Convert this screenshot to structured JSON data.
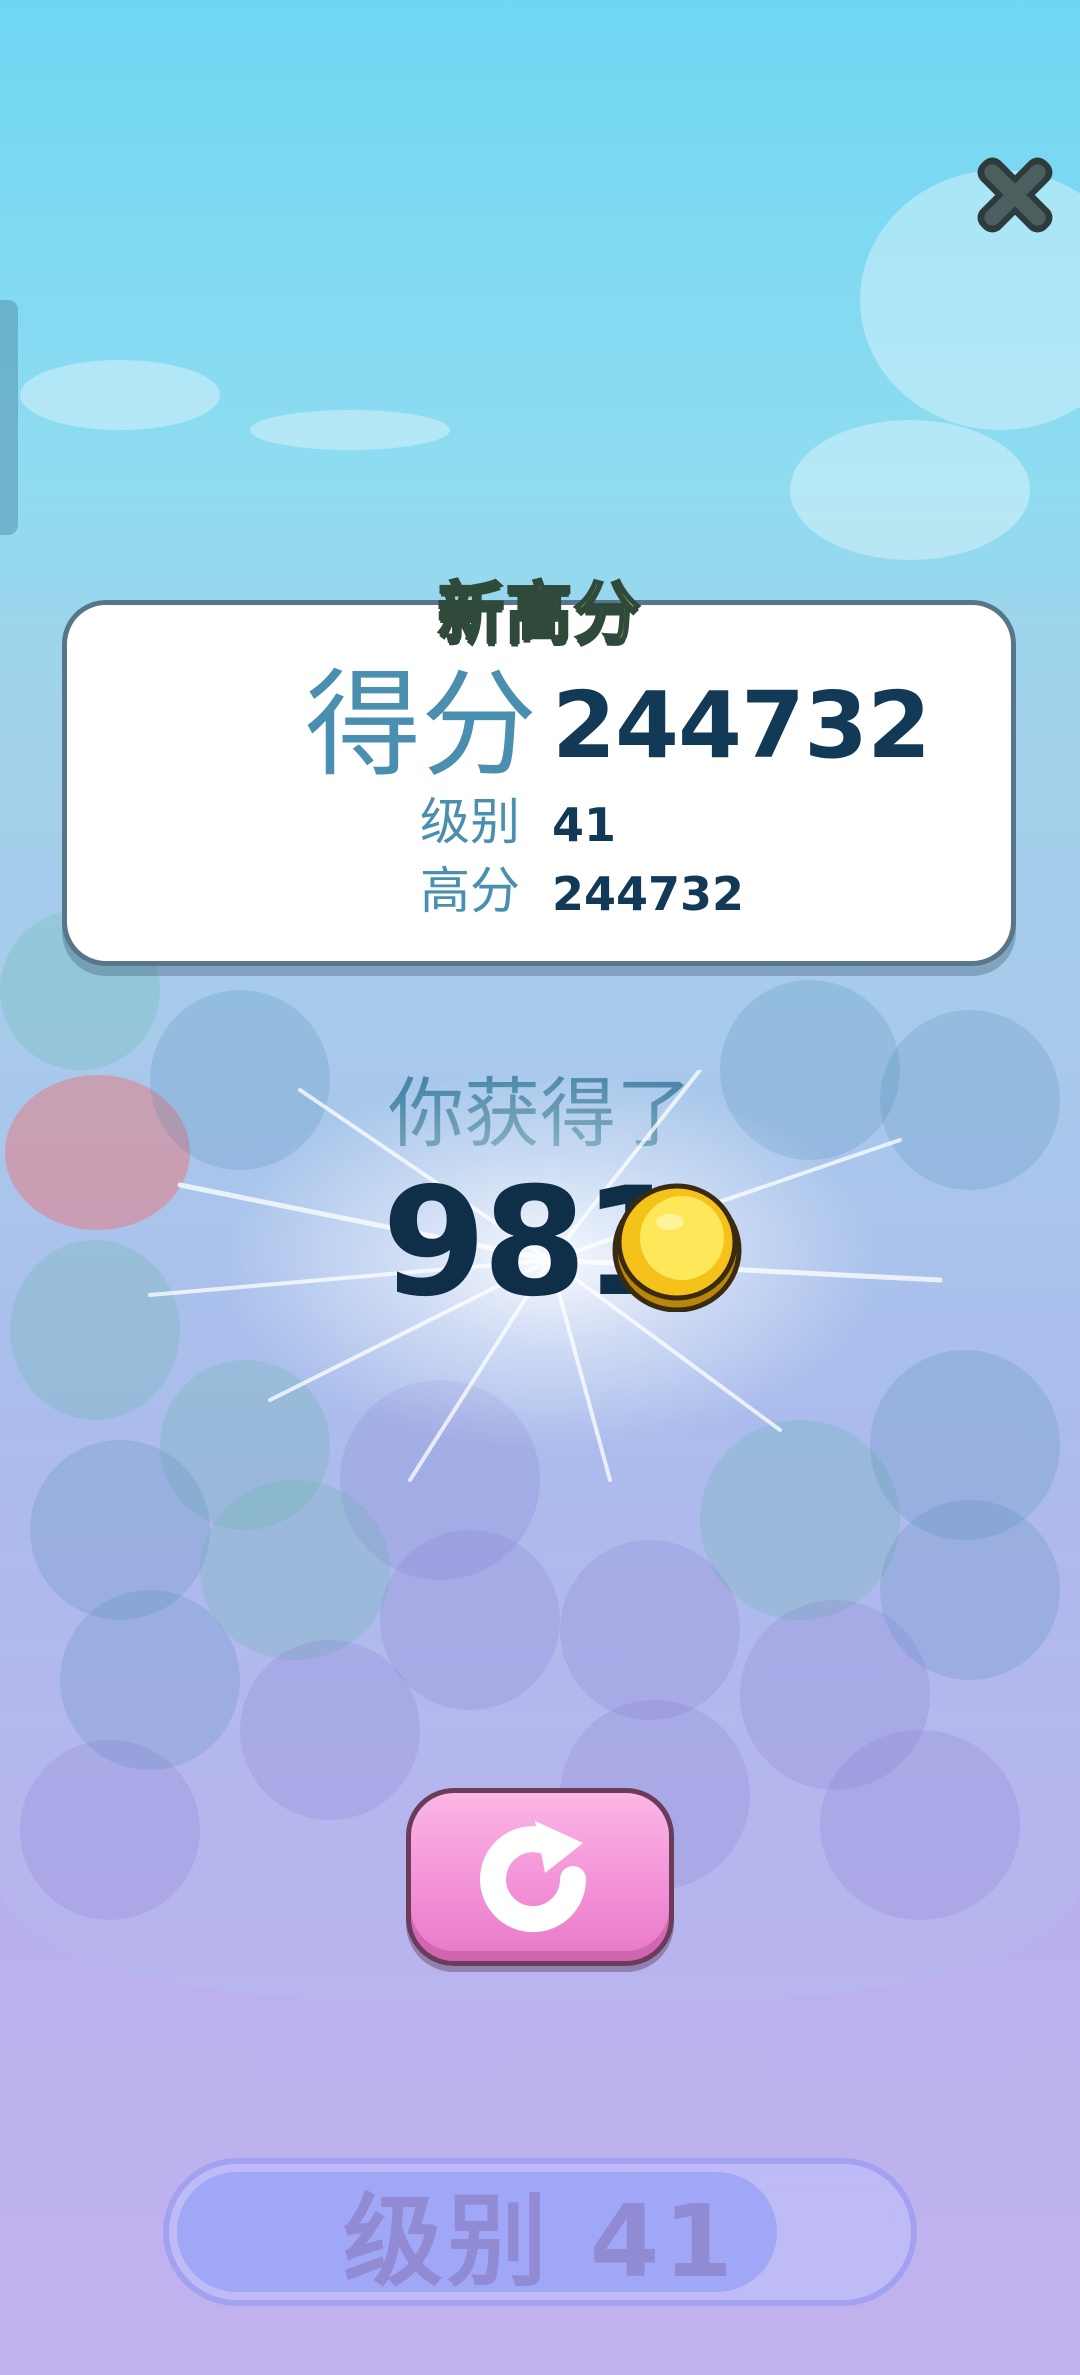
{
  "header": {
    "new_high_score_label": "新高分"
  },
  "score_card": {
    "score_label": "得分",
    "score_value": "244732",
    "level_label": "级别",
    "level_value": "41",
    "best_label": "高分",
    "best_value": "244732"
  },
  "reward": {
    "earned_label": "你获得了",
    "coin_amount": "981",
    "coin_icon": "gold-coin-icon"
  },
  "controls": {
    "close_icon": "close-x-icon",
    "restart_icon": "restart-arrow-icon"
  },
  "level_bar": {
    "label": "级别 41"
  },
  "colors": {
    "accent_text": "#4a8fb0",
    "value_text": "#123a57",
    "new_high_yellow": "#f6f05a",
    "restart_pink": "#f28fd6"
  }
}
